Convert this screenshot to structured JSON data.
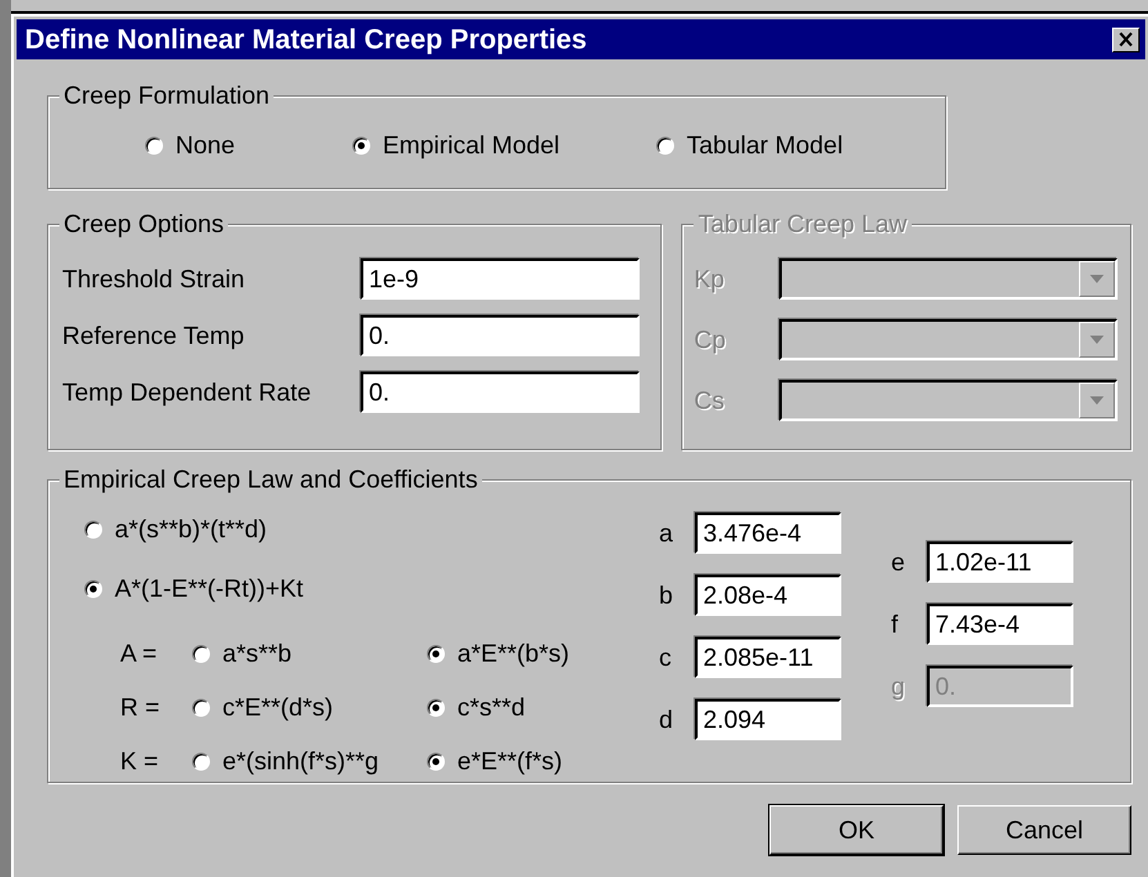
{
  "window": {
    "title": "Define Nonlinear Material Creep Properties"
  },
  "formulation": {
    "title": "Creep Formulation",
    "options": [
      {
        "label": "None",
        "selected": false
      },
      {
        "label": "Empirical Model",
        "selected": true
      },
      {
        "label": "Tabular Model",
        "selected": false
      }
    ]
  },
  "creep_options": {
    "title": "Creep Options",
    "fields": [
      {
        "label": "Threshold Strain",
        "value": "1e-9"
      },
      {
        "label": "Reference Temp",
        "value": "0."
      },
      {
        "label": "Temp Dependent Rate",
        "value": "0."
      }
    ]
  },
  "tabular_law": {
    "title": "Tabular Creep Law",
    "disabled": true,
    "fields": [
      {
        "label": "Kp"
      },
      {
        "label": "Cp"
      },
      {
        "label": "Cs"
      }
    ]
  },
  "empirical": {
    "title": "Empirical Creep Law and Coefficients",
    "laws": [
      {
        "label": "a*(s**b)*(t**d)",
        "selected": false
      },
      {
        "label": "A*(1-E**(-Rt))+Kt",
        "selected": true
      }
    ],
    "terms": [
      {
        "label": "A =",
        "options": [
          {
            "label": "a*s**b",
            "selected": false
          },
          {
            "label": "a*E**(b*s)",
            "selected": true
          }
        ]
      },
      {
        "label": "R =",
        "options": [
          {
            "label": "c*E**(d*s)",
            "selected": false
          },
          {
            "label": "c*s**d",
            "selected": true
          }
        ]
      },
      {
        "label": "K =",
        "options": [
          {
            "label": "e*(sinh(f*s)**g",
            "selected": false
          },
          {
            "label": "e*E**(f*s)",
            "selected": true
          }
        ]
      }
    ],
    "coefficients_left": [
      {
        "label": "a",
        "value": "3.476e-4",
        "disabled": false
      },
      {
        "label": "b",
        "value": "2.08e-4",
        "disabled": false
      },
      {
        "label": "c",
        "value": "2.085e-11",
        "disabled": false
      },
      {
        "label": "d",
        "value": "2.094",
        "disabled": false
      }
    ],
    "coefficients_right": [
      {
        "label": "e",
        "value": "1.02e-11",
        "disabled": false
      },
      {
        "label": "f",
        "value": "7.43e-4",
        "disabled": false
      },
      {
        "label": "g",
        "value": "0.",
        "disabled": true
      }
    ]
  },
  "buttons": [
    {
      "label": "OK",
      "default": true
    },
    {
      "label": "Cancel",
      "default": false
    }
  ]
}
